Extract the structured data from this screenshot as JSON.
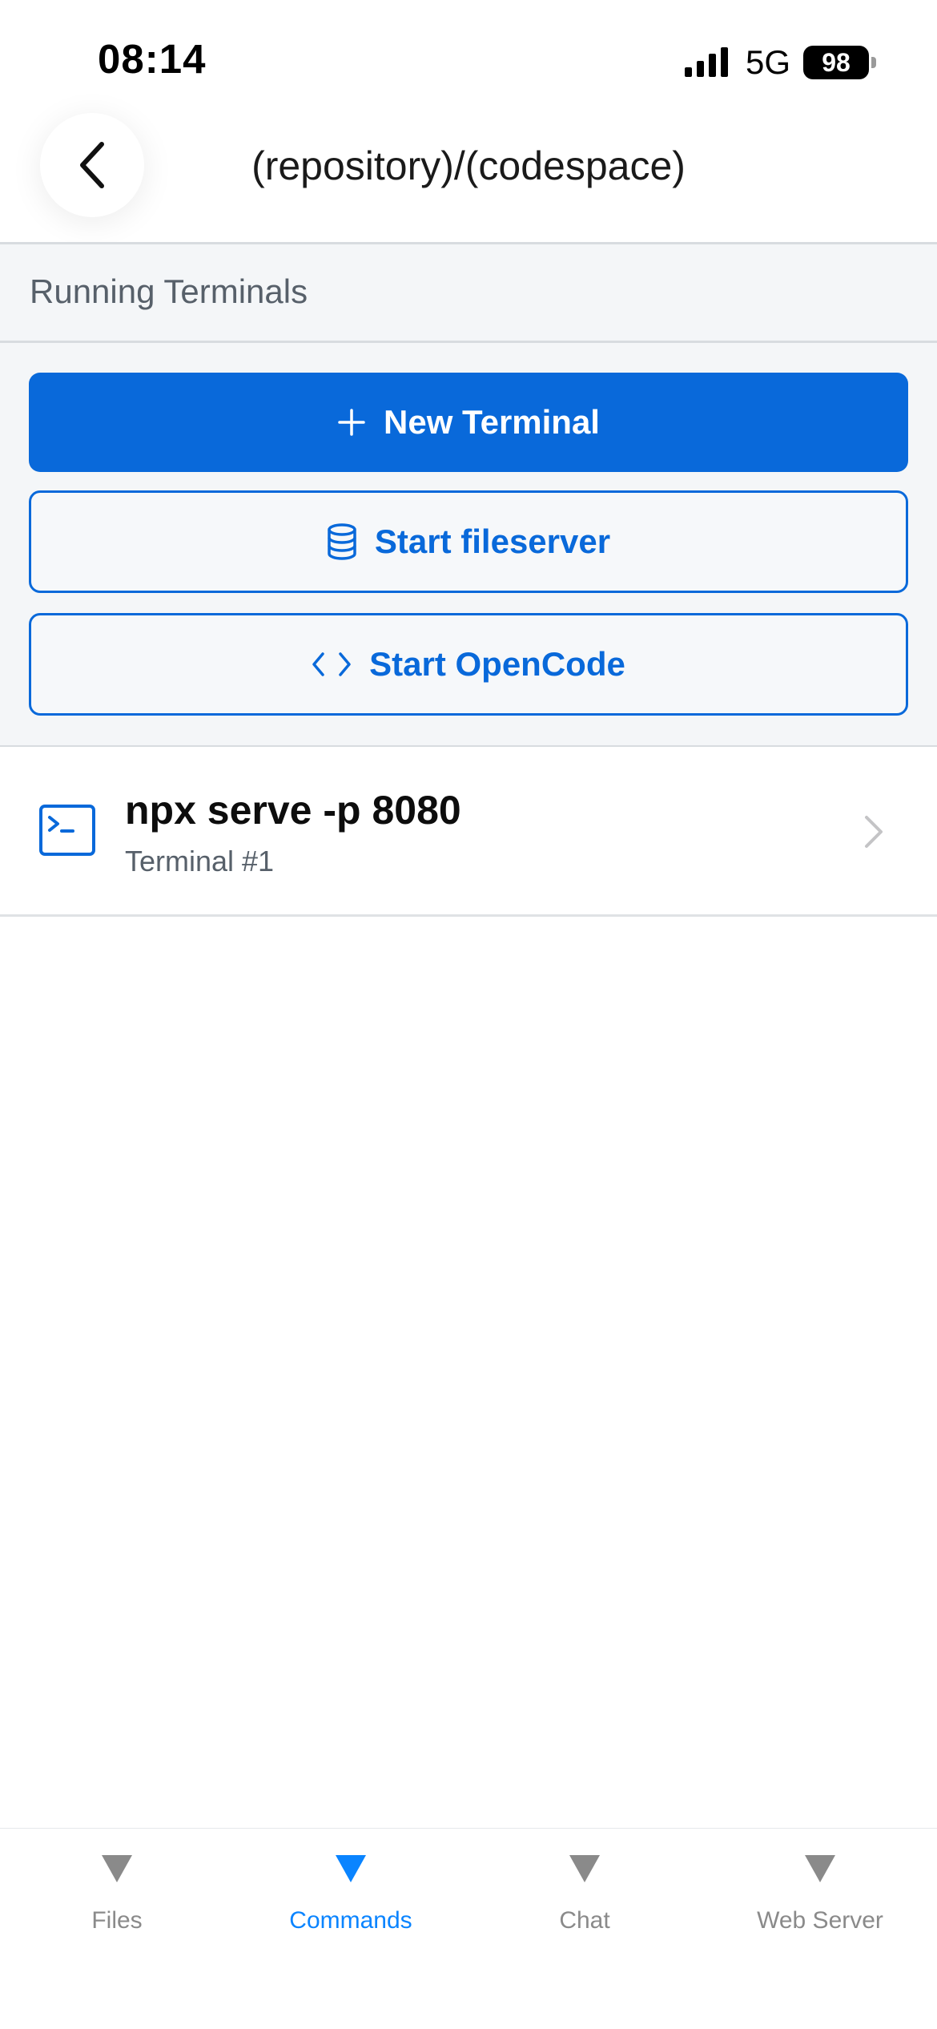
{
  "status_bar": {
    "time": "08:14",
    "network": "5G",
    "battery": "98"
  },
  "header": {
    "title": "(repository)/(codespace)",
    "back_icon": "chevron-left-icon"
  },
  "section": {
    "title": "Running Terminals"
  },
  "actions": {
    "new_terminal": {
      "label": "New Terminal",
      "icon": "plus-icon"
    },
    "start_fileserver": {
      "label": "Start fileserver",
      "icon": "database-icon"
    },
    "start_opencode": {
      "label": "Start OpenCode",
      "icon": "code-icon"
    }
  },
  "terminals": [
    {
      "command": "npx serve -p 8080",
      "name": "Terminal #1",
      "icon": "terminal-icon"
    }
  ],
  "tab_bar": {
    "tabs": [
      {
        "label": "Files",
        "active": false
      },
      {
        "label": "Commands",
        "active": true
      },
      {
        "label": "Chat",
        "active": false
      },
      {
        "label": "Web Server",
        "active": false
      }
    ]
  },
  "colors": {
    "accent": "#0969da",
    "tab_active": "#0a84ff",
    "tab_inactive": "#8a8a8a",
    "section_bg": "#f4f6f8"
  }
}
